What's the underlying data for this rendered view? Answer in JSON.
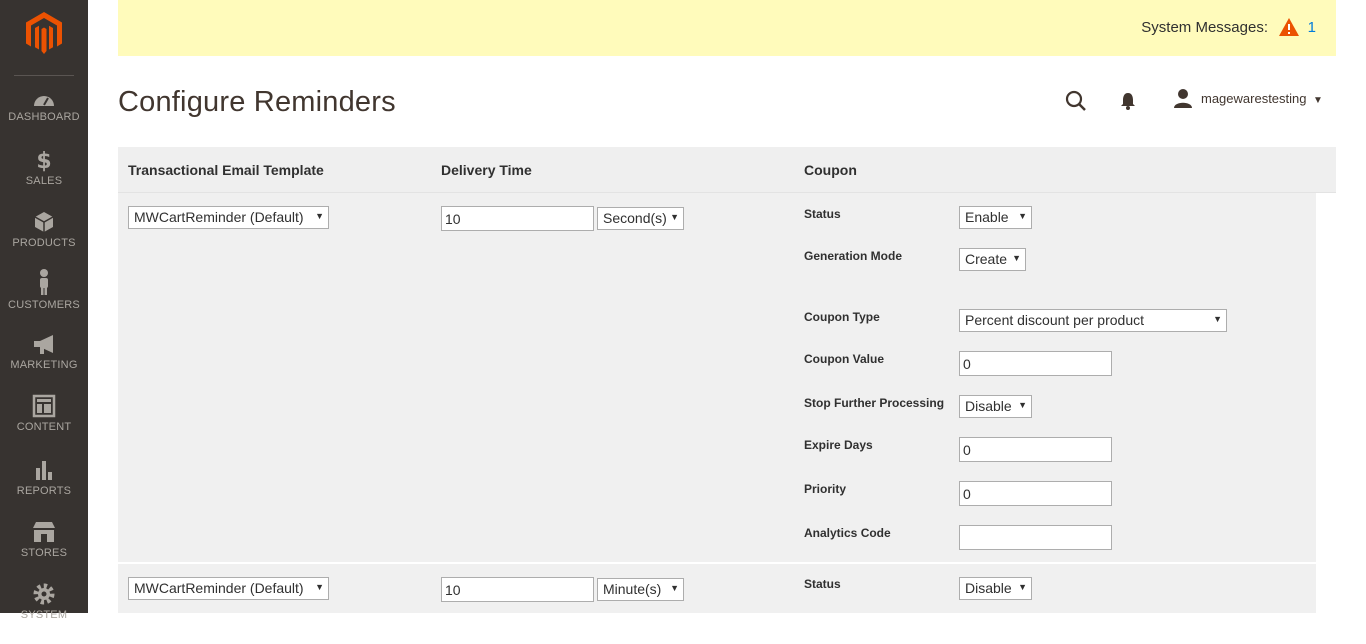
{
  "sidebar": {
    "items": [
      {
        "label": "DASHBOARD",
        "icon": "dashboard-icon"
      },
      {
        "label": "SALES",
        "icon": "dollar-icon"
      },
      {
        "label": "PRODUCTS",
        "icon": "box-icon"
      },
      {
        "label": "CUSTOMERS",
        "icon": "person-icon"
      },
      {
        "label": "MARKETING",
        "icon": "megaphone-icon"
      },
      {
        "label": "CONTENT",
        "icon": "layout-icon"
      },
      {
        "label": "REPORTS",
        "icon": "bar-chart-icon"
      },
      {
        "label": "STORES",
        "icon": "storefront-icon"
      },
      {
        "label": "SYSTEM",
        "icon": "gear-icon"
      }
    ]
  },
  "system_messages": {
    "label": "System Messages:",
    "count": "1"
  },
  "header": {
    "title": "Configure Reminders",
    "username": "magewarestesting"
  },
  "grid": {
    "columns": [
      "Transactional Email Template",
      "Delivery Time",
      "Coupon"
    ],
    "rows": [
      {
        "template": "MWCartReminder (Default)",
        "delivery_value": "10",
        "delivery_unit": "Second(s)",
        "coupon": {
          "status_label": "Status",
          "status": "Enable",
          "generation_mode_label": "Generation Mode",
          "generation_mode": "Create",
          "coupon_type_label": "Coupon Type",
          "coupon_type": "Percent discount per product",
          "coupon_value_label": "Coupon Value",
          "coupon_value": "0",
          "stop_processing_label": "Stop Further Processing",
          "stop_processing": "Disable",
          "expire_days_label": "Expire Days",
          "expire_days": "0",
          "priority_label": "Priority",
          "priority": "0",
          "analytics_code_label": "Analytics Code",
          "analytics_code": ""
        }
      },
      {
        "template": "MWCartReminder (Default)",
        "delivery_value": "10",
        "delivery_unit": "Minute(s)",
        "coupon": {
          "status_label": "Status",
          "status": "Disable"
        }
      }
    ]
  },
  "colors": {
    "sidebar": "#373330",
    "logo": "#eb5202",
    "message_bar": "#fffbbb",
    "link": "#007bdb"
  }
}
